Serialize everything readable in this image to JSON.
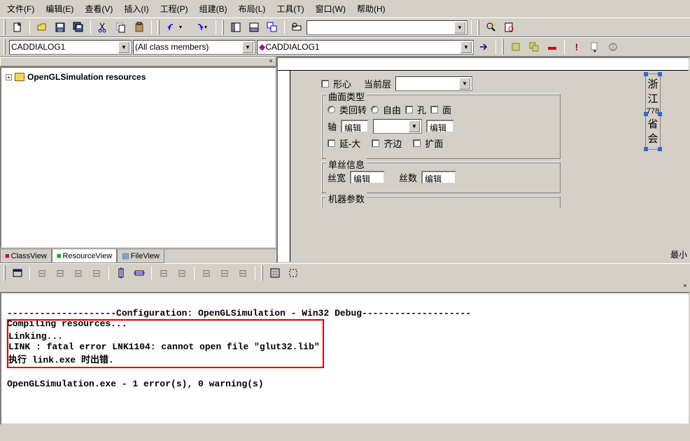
{
  "menubar": {
    "items": [
      "文件(F)",
      "编辑(E)",
      "查看(V)",
      "插入(I)",
      "工程(P)",
      "组建(B)",
      "布局(L)",
      "工具(T)",
      "窗口(W)",
      "帮助(H)"
    ]
  },
  "combo1": {
    "value": "CADDIALOG1"
  },
  "combo2": {
    "value": "(All class members)"
  },
  "combo3": {
    "value": "CADDIALOG1"
  },
  "tree": {
    "root": "OpenGLSimulation resources"
  },
  "tabs": {
    "items": [
      "ClassView",
      "ResourceView",
      "FileView"
    ],
    "active": 1
  },
  "dialog": {
    "row0": {
      "label1": "形心",
      "label2": "当前层"
    },
    "group1": {
      "title": "曲面类型",
      "r1": "类回转",
      "r2": "自由",
      "c1": "孔",
      "c2": "面",
      "axis": "轴",
      "edit1": "编辑",
      "edit2": "编辑",
      "c3": "延-大",
      "c4": "齐边",
      "c5": "扩面"
    },
    "group2": {
      "title": "单丝信息",
      "l1": "丝宽",
      "e1": "编辑",
      "l2": "丝数",
      "e2": "编辑"
    },
    "group3": {
      "title": "机器参数"
    },
    "vtext": {
      "l1": "浙",
      "l2": "江",
      "l3": "778",
      "l4": "省",
      "l5": "会"
    },
    "corner": "最小"
  },
  "output": {
    "line1": "--------------------Configuration: OpenGLSimulation - Win32 Debug--------------------",
    "line2": "Compiling resources...",
    "line3": "Linking...",
    "line4": "LINK : fatal error LNK1104: cannot open file \"glut32.lib\"",
    "line5": "执行 link.exe 时出错.",
    "line6": "OpenGLSimulation.exe - 1 error(s), 0 warning(s)"
  }
}
